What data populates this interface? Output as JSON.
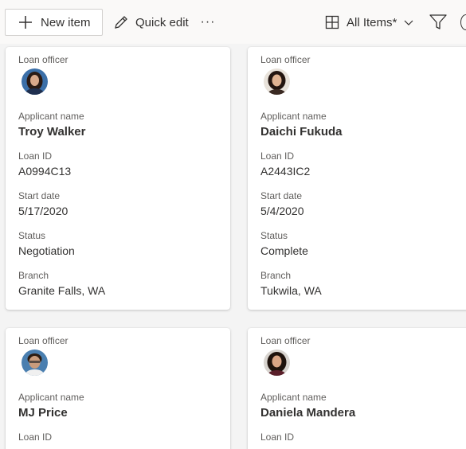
{
  "toolbar": {
    "new_item_label": "New item",
    "quick_edit_label": "Quick edit",
    "more_label": "···",
    "view_label": "All Items*"
  },
  "field_labels": {
    "loan_officer": "Loan officer",
    "applicant_name": "Applicant name",
    "loan_id": "Loan ID",
    "start_date": "Start date",
    "status": "Status",
    "branch": "Branch"
  },
  "cards": [
    {
      "applicant_name": "Troy Walker",
      "loan_id": "A0994C13",
      "start_date": "5/17/2020",
      "status": "Negotiation",
      "branch": "Granite Falls, WA"
    },
    {
      "applicant_name": "Daichi Fukuda",
      "loan_id": "A2443IC2",
      "start_date": "5/4/2020",
      "status": "Complete",
      "branch": "Tukwila, WA"
    },
    {
      "applicant_name": "MJ Price"
    },
    {
      "applicant_name": "Daniela Mandera"
    }
  ],
  "colors": {
    "page_background": "#f4f4f4",
    "toolbar_background": "#faf9f8",
    "card_background": "#ffffff",
    "label_text": "#605e5c",
    "value_text": "#323130"
  }
}
